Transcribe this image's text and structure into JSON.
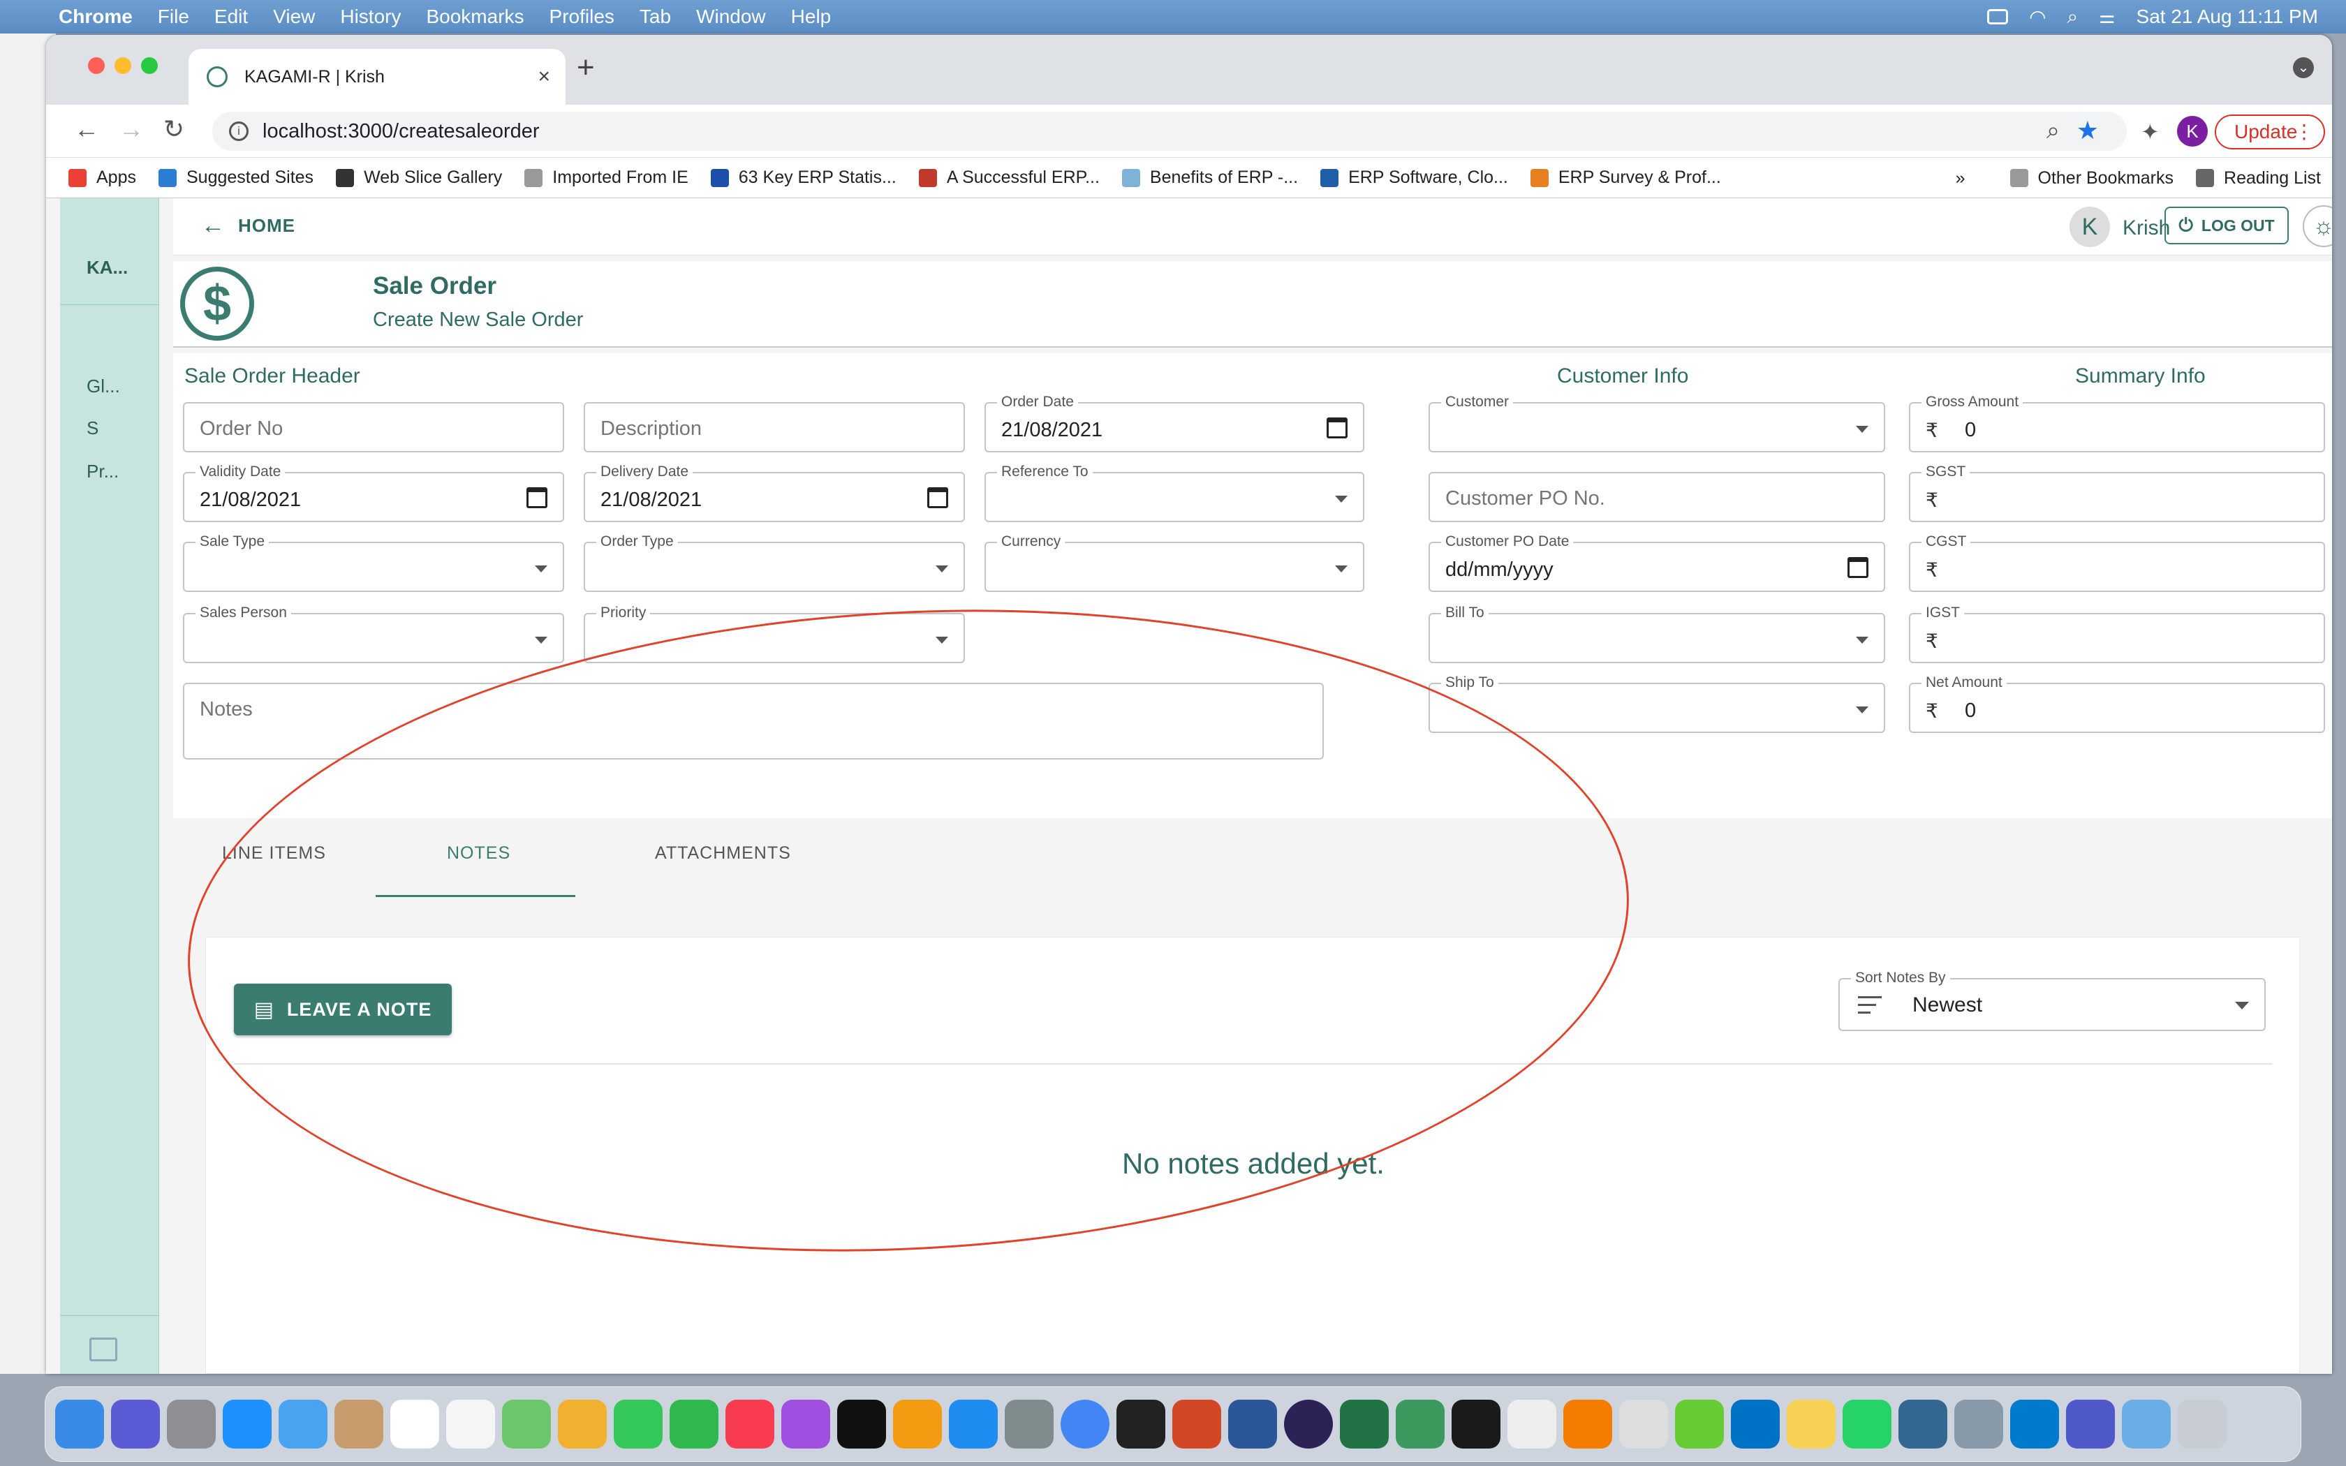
{
  "menubar": {
    "app": "Chrome",
    "items": [
      "File",
      "Edit",
      "View",
      "History",
      "Bookmarks",
      "Profiles",
      "Tab",
      "Window",
      "Help"
    ],
    "clock": "Sat 21 Aug  11:11 PM"
  },
  "browser": {
    "tab_title": "KAGAMI-R | Krish",
    "url": "localhost:3000/createsaleorder",
    "profile_initial": "K",
    "update_label": "Update",
    "bookmarks": [
      "Apps",
      "Suggested Sites",
      "Web Slice Gallery",
      "Imported From IE",
      "63 Key ERP Statis...",
      "A Successful ERP...",
      "Benefits of ERP -...",
      "ERP Software, Clo...",
      "ERP Survey & Prof..."
    ],
    "bookmarks_more": "»",
    "other_bookmarks": "Other Bookmarks",
    "reading_list": "Reading List"
  },
  "sidebar": {
    "brand": "KA...",
    "items": [
      "Gl...",
      "S",
      "Pr..."
    ]
  },
  "header": {
    "home": "HOME",
    "user_initial": "K",
    "user_name": "Krish",
    "logout": "LOG OUT"
  },
  "page": {
    "title": "Sale Order",
    "subtitle": "Create New Sale Order",
    "currency_symbol": "₹"
  },
  "sections": {
    "header": "Sale Order Header",
    "customer": "Customer Info",
    "summary": "Summary Info"
  },
  "fields": {
    "order_no": {
      "placeholder": "Order No"
    },
    "description": {
      "placeholder": "Description"
    },
    "order_date": {
      "label": "Order Date",
      "value": "21/08/2021"
    },
    "validity_date": {
      "label": "Validity Date",
      "value": "21/08/2021"
    },
    "delivery_date": {
      "label": "Delivery Date",
      "value": "21/08/2021"
    },
    "reference_to": {
      "label": "Reference To"
    },
    "sale_type": {
      "label": "Sale Type"
    },
    "order_type": {
      "label": "Order Type"
    },
    "currency": {
      "label": "Currency"
    },
    "sales_person": {
      "label": "Sales Person"
    },
    "priority": {
      "label": "Priority"
    },
    "notes": {
      "placeholder": "Notes"
    },
    "customer": {
      "label": "Customer"
    },
    "customer_po_no": {
      "placeholder": "Customer PO No."
    },
    "customer_po_date": {
      "label": "Customer PO Date",
      "value": "dd/mm/yyyy"
    },
    "bill_to": {
      "label": "Bill To"
    },
    "ship_to": {
      "label": "Ship To"
    },
    "gross_amount": {
      "label": "Gross Amount",
      "value": "0"
    },
    "sgst": {
      "label": "SGST"
    },
    "cgst": {
      "label": "CGST"
    },
    "igst": {
      "label": "IGST"
    },
    "net_amount": {
      "label": "Net Amount",
      "value": "0"
    }
  },
  "tabs": {
    "line_items": "LINE ITEMS",
    "notes": "NOTES",
    "attachments": "ATTACHMENTS",
    "active": "notes"
  },
  "notes_panel": {
    "leave_note": "LEAVE A NOTE",
    "sort_label": "Sort Notes By",
    "sort_value": "Newest",
    "empty": "No notes added yet."
  },
  "annotation_color": "#e0432a",
  "accent": "#3a7d70"
}
